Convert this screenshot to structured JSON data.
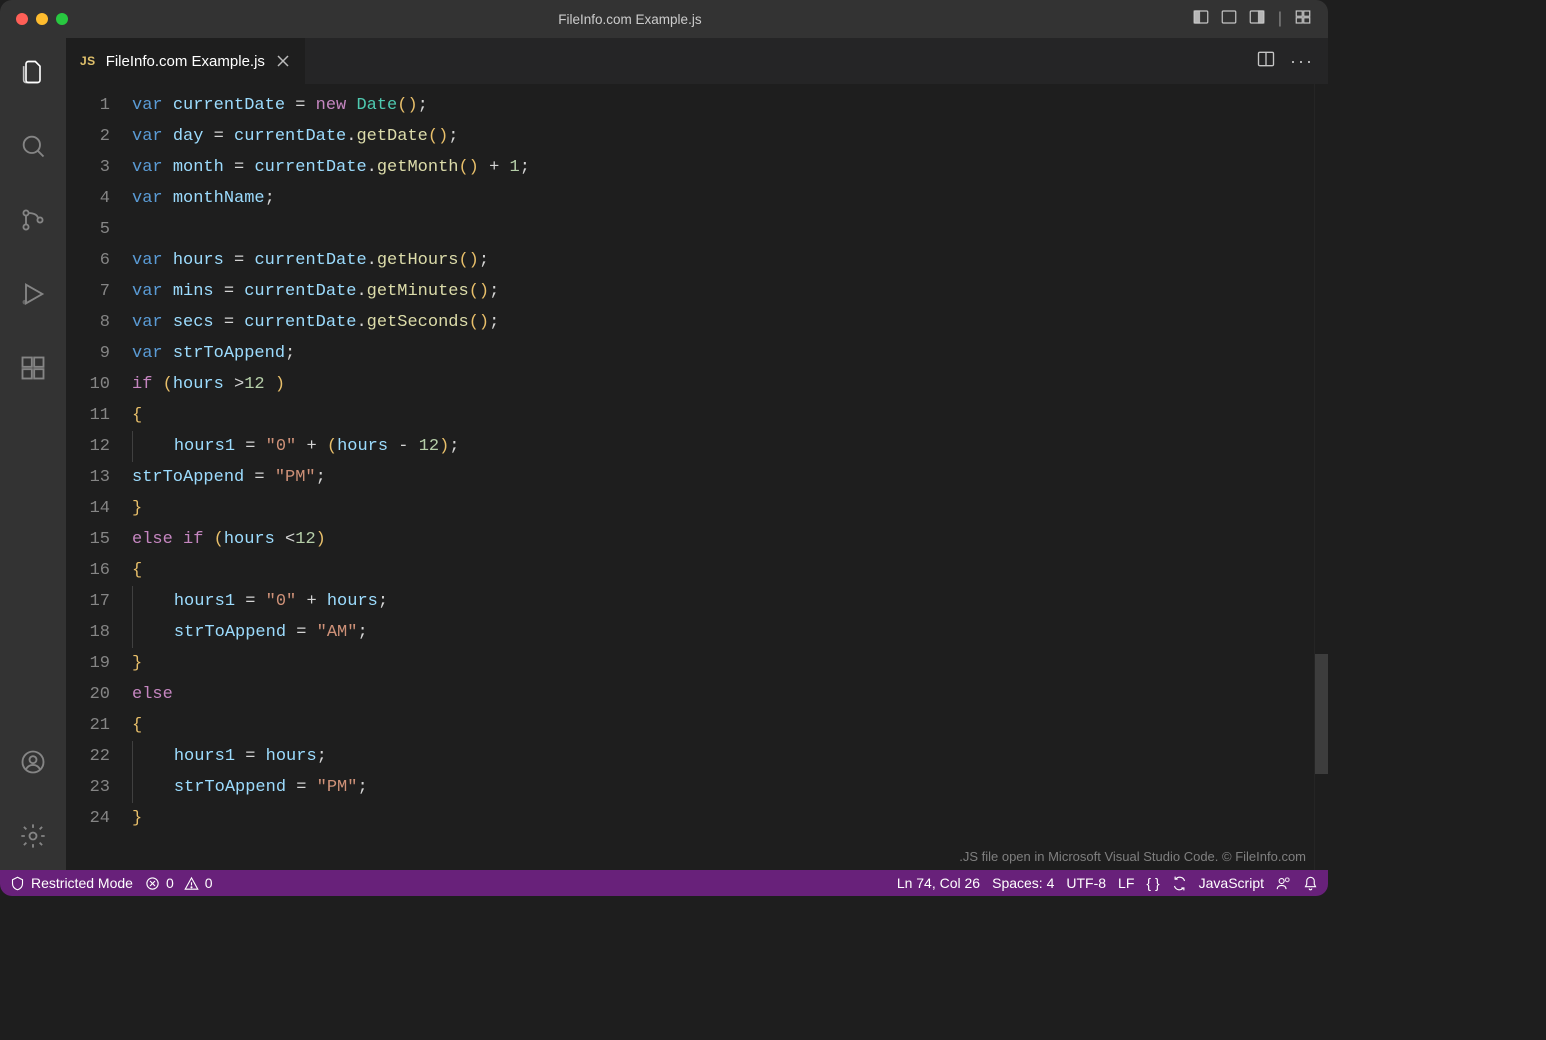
{
  "title": "FileInfo.com Example.js",
  "tab": {
    "badge": "JS",
    "filename": "FileInfo.com Example.js"
  },
  "watermark": ".JS file open in Microsoft Visual Studio Code. © FileInfo.com",
  "status": {
    "restricted": "Restricted Mode",
    "errors": "0",
    "warnings": "0",
    "cursor": "Ln 74, Col 26",
    "spaces": "Spaces: 4",
    "encoding": "UTF-8",
    "eol": "LF",
    "language": "JavaScript"
  },
  "code": {
    "lines": [
      [
        {
          "t": "kw",
          "s": "var"
        },
        {
          "t": "pl",
          "s": " "
        },
        {
          "t": "var",
          "s": "currentDate"
        },
        {
          "t": "pl",
          "s": " "
        },
        {
          "t": "op",
          "s": "="
        },
        {
          "t": "pl",
          "s": " "
        },
        {
          "t": "kw2",
          "s": "new"
        },
        {
          "t": "pl",
          "s": " "
        },
        {
          "t": "cls",
          "s": "Date"
        },
        {
          "t": "pn",
          "s": "()"
        },
        {
          "t": "semi",
          "s": ";"
        }
      ],
      [
        {
          "t": "kw",
          "s": "var"
        },
        {
          "t": "pl",
          "s": " "
        },
        {
          "t": "var",
          "s": "day"
        },
        {
          "t": "pl",
          "s": " "
        },
        {
          "t": "op",
          "s": "="
        },
        {
          "t": "pl",
          "s": " "
        },
        {
          "t": "var",
          "s": "currentDate"
        },
        {
          "t": "op",
          "s": "."
        },
        {
          "t": "fn",
          "s": "getDate"
        },
        {
          "t": "pn",
          "s": "()"
        },
        {
          "t": "semi",
          "s": ";"
        }
      ],
      [
        {
          "t": "kw",
          "s": "var"
        },
        {
          "t": "pl",
          "s": " "
        },
        {
          "t": "var",
          "s": "month"
        },
        {
          "t": "pl",
          "s": " "
        },
        {
          "t": "op",
          "s": "="
        },
        {
          "t": "pl",
          "s": " "
        },
        {
          "t": "var",
          "s": "currentDate"
        },
        {
          "t": "op",
          "s": "."
        },
        {
          "t": "fn",
          "s": "getMonth"
        },
        {
          "t": "pn",
          "s": "()"
        },
        {
          "t": "pl",
          "s": " "
        },
        {
          "t": "op",
          "s": "+"
        },
        {
          "t": "pl",
          "s": " "
        },
        {
          "t": "num",
          "s": "1"
        },
        {
          "t": "semi",
          "s": ";"
        }
      ],
      [
        {
          "t": "kw",
          "s": "var"
        },
        {
          "t": "pl",
          "s": " "
        },
        {
          "t": "var",
          "s": "monthName"
        },
        {
          "t": "semi",
          "s": ";"
        }
      ],
      [],
      [
        {
          "t": "kw",
          "s": "var"
        },
        {
          "t": "pl",
          "s": " "
        },
        {
          "t": "var",
          "s": "hours"
        },
        {
          "t": "pl",
          "s": " "
        },
        {
          "t": "op",
          "s": "="
        },
        {
          "t": "pl",
          "s": " "
        },
        {
          "t": "var",
          "s": "currentDate"
        },
        {
          "t": "op",
          "s": "."
        },
        {
          "t": "fn",
          "s": "getHours"
        },
        {
          "t": "pn",
          "s": "()"
        },
        {
          "t": "semi",
          "s": ";"
        }
      ],
      [
        {
          "t": "kw",
          "s": "var"
        },
        {
          "t": "pl",
          "s": " "
        },
        {
          "t": "var",
          "s": "mins"
        },
        {
          "t": "pl",
          "s": " "
        },
        {
          "t": "op",
          "s": "="
        },
        {
          "t": "pl",
          "s": " "
        },
        {
          "t": "var",
          "s": "currentDate"
        },
        {
          "t": "op",
          "s": "."
        },
        {
          "t": "fn",
          "s": "getMinutes"
        },
        {
          "t": "pn",
          "s": "()"
        },
        {
          "t": "semi",
          "s": ";"
        }
      ],
      [
        {
          "t": "kw",
          "s": "var"
        },
        {
          "t": "pl",
          "s": " "
        },
        {
          "t": "var",
          "s": "secs"
        },
        {
          "t": "pl",
          "s": " "
        },
        {
          "t": "op",
          "s": "="
        },
        {
          "t": "pl",
          "s": " "
        },
        {
          "t": "var",
          "s": "currentDate"
        },
        {
          "t": "op",
          "s": "."
        },
        {
          "t": "fn",
          "s": "getSeconds"
        },
        {
          "t": "pn",
          "s": "()"
        },
        {
          "t": "semi",
          "s": ";"
        }
      ],
      [
        {
          "t": "kw",
          "s": "var"
        },
        {
          "t": "pl",
          "s": " "
        },
        {
          "t": "var",
          "s": "strToAppend"
        },
        {
          "t": "semi",
          "s": ";"
        }
      ],
      [
        {
          "t": "kw2",
          "s": "if"
        },
        {
          "t": "pl",
          "s": " "
        },
        {
          "t": "pn",
          "s": "("
        },
        {
          "t": "var",
          "s": "hours"
        },
        {
          "t": "pl",
          "s": " "
        },
        {
          "t": "op",
          "s": ">"
        },
        {
          "t": "num",
          "s": "12"
        },
        {
          "t": "pl",
          "s": " "
        },
        {
          "t": "pn",
          "s": ")"
        }
      ],
      [
        {
          "t": "pn",
          "s": "{"
        }
      ],
      [
        {
          "t": "indent",
          "s": 4
        },
        {
          "t": "var",
          "s": "hours1"
        },
        {
          "t": "pl",
          "s": " "
        },
        {
          "t": "op",
          "s": "="
        },
        {
          "t": "pl",
          "s": " "
        },
        {
          "t": "str",
          "s": "\"0\""
        },
        {
          "t": "pl",
          "s": " "
        },
        {
          "t": "op",
          "s": "+"
        },
        {
          "t": "pl",
          "s": " "
        },
        {
          "t": "pn",
          "s": "("
        },
        {
          "t": "var",
          "s": "hours"
        },
        {
          "t": "pl",
          "s": " "
        },
        {
          "t": "op",
          "s": "-"
        },
        {
          "t": "pl",
          "s": " "
        },
        {
          "t": "num",
          "s": "12"
        },
        {
          "t": "pn",
          "s": ")"
        },
        {
          "t": "semi",
          "s": ";"
        }
      ],
      [
        {
          "t": "var",
          "s": "strToAppend"
        },
        {
          "t": "pl",
          "s": " "
        },
        {
          "t": "op",
          "s": "="
        },
        {
          "t": "pl",
          "s": " "
        },
        {
          "t": "str",
          "s": "\"PM\""
        },
        {
          "t": "semi",
          "s": ";"
        }
      ],
      [
        {
          "t": "pn",
          "s": "}"
        }
      ],
      [
        {
          "t": "kw2",
          "s": "else"
        },
        {
          "t": "pl",
          "s": " "
        },
        {
          "t": "kw2",
          "s": "if"
        },
        {
          "t": "pl",
          "s": " "
        },
        {
          "t": "pn",
          "s": "("
        },
        {
          "t": "var",
          "s": "hours"
        },
        {
          "t": "pl",
          "s": " "
        },
        {
          "t": "op",
          "s": "<"
        },
        {
          "t": "num",
          "s": "12"
        },
        {
          "t": "pn",
          "s": ")"
        }
      ],
      [
        {
          "t": "pn",
          "s": "{"
        }
      ],
      [
        {
          "t": "indent",
          "s": 4
        },
        {
          "t": "var",
          "s": "hours1"
        },
        {
          "t": "pl",
          "s": " "
        },
        {
          "t": "op",
          "s": "="
        },
        {
          "t": "pl",
          "s": " "
        },
        {
          "t": "str",
          "s": "\"0\""
        },
        {
          "t": "pl",
          "s": " "
        },
        {
          "t": "op",
          "s": "+"
        },
        {
          "t": "pl",
          "s": " "
        },
        {
          "t": "var",
          "s": "hours"
        },
        {
          "t": "semi",
          "s": ";"
        }
      ],
      [
        {
          "t": "indent",
          "s": 4
        },
        {
          "t": "var",
          "s": "strToAppend"
        },
        {
          "t": "pl",
          "s": " "
        },
        {
          "t": "op",
          "s": "="
        },
        {
          "t": "pl",
          "s": " "
        },
        {
          "t": "str",
          "s": "\"AM\""
        },
        {
          "t": "semi",
          "s": ";"
        }
      ],
      [
        {
          "t": "pn",
          "s": "}"
        }
      ],
      [
        {
          "t": "kw2",
          "s": "else"
        }
      ],
      [
        {
          "t": "pn",
          "s": "{"
        }
      ],
      [
        {
          "t": "indent",
          "s": 4
        },
        {
          "t": "var",
          "s": "hours1"
        },
        {
          "t": "pl",
          "s": " "
        },
        {
          "t": "op",
          "s": "="
        },
        {
          "t": "pl",
          "s": " "
        },
        {
          "t": "var",
          "s": "hours"
        },
        {
          "t": "semi",
          "s": ";"
        }
      ],
      [
        {
          "t": "indent",
          "s": 4
        },
        {
          "t": "var",
          "s": "strToAppend"
        },
        {
          "t": "pl",
          "s": " "
        },
        {
          "t": "op",
          "s": "="
        },
        {
          "t": "pl",
          "s": " "
        },
        {
          "t": "str",
          "s": "\"PM\""
        },
        {
          "t": "semi",
          "s": ";"
        }
      ],
      [
        {
          "t": "pn",
          "s": "}"
        }
      ]
    ]
  }
}
